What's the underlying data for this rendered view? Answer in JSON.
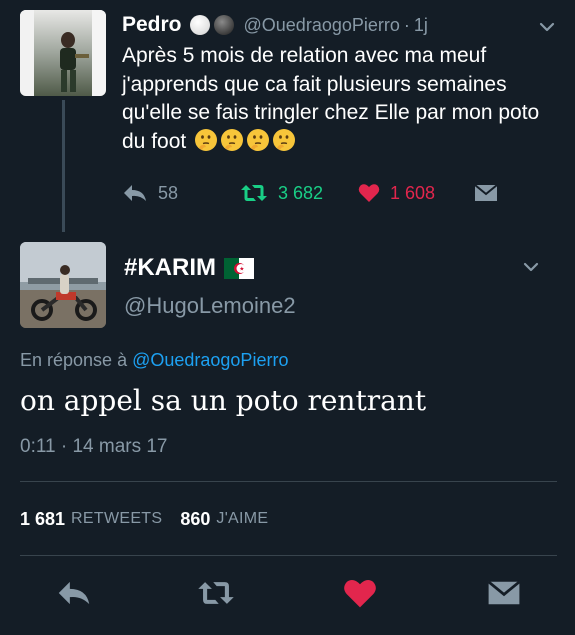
{
  "tweet1": {
    "name": "Pedro",
    "handle": "@OuedraogoPierro",
    "separator": "·",
    "time": "1j",
    "text": "Après 5 mois de relation avec ma meuf j'apprends que ca fait plusieurs semaines qu'elle se fais tringler chez Elle par mon poto du foot",
    "emoji_icon": "thinking-face-emoji",
    "emoji_count": 4,
    "actions": {
      "reply_count": "58",
      "retweet_count": "3 682",
      "like_count": "1 608"
    }
  },
  "tweet2": {
    "name": "#KARIM",
    "flag_icon": "algeria-flag-icon",
    "handle": "@HugoLemoine2",
    "reply_prefix": "En réponse à",
    "reply_mention": "@OuedraogoPierro",
    "text": "on appel sa un poto rentrant",
    "timestamp": "0:11 · 14 mars 17",
    "retweets": "1 681",
    "retweets_label": "RETWEETS",
    "likes": "860",
    "likes_label": "J'AIME"
  },
  "colors": {
    "background": "#141d26",
    "muted_text": "#8899a6",
    "retweet_green": "#19cf86",
    "like_red": "#e2264d",
    "link_blue": "#1da1f2",
    "divider": "#38444d"
  },
  "icons": [
    "reply-icon",
    "retweet-icon",
    "heart-icon",
    "direct-message-icon",
    "chevron-down-icon"
  ]
}
